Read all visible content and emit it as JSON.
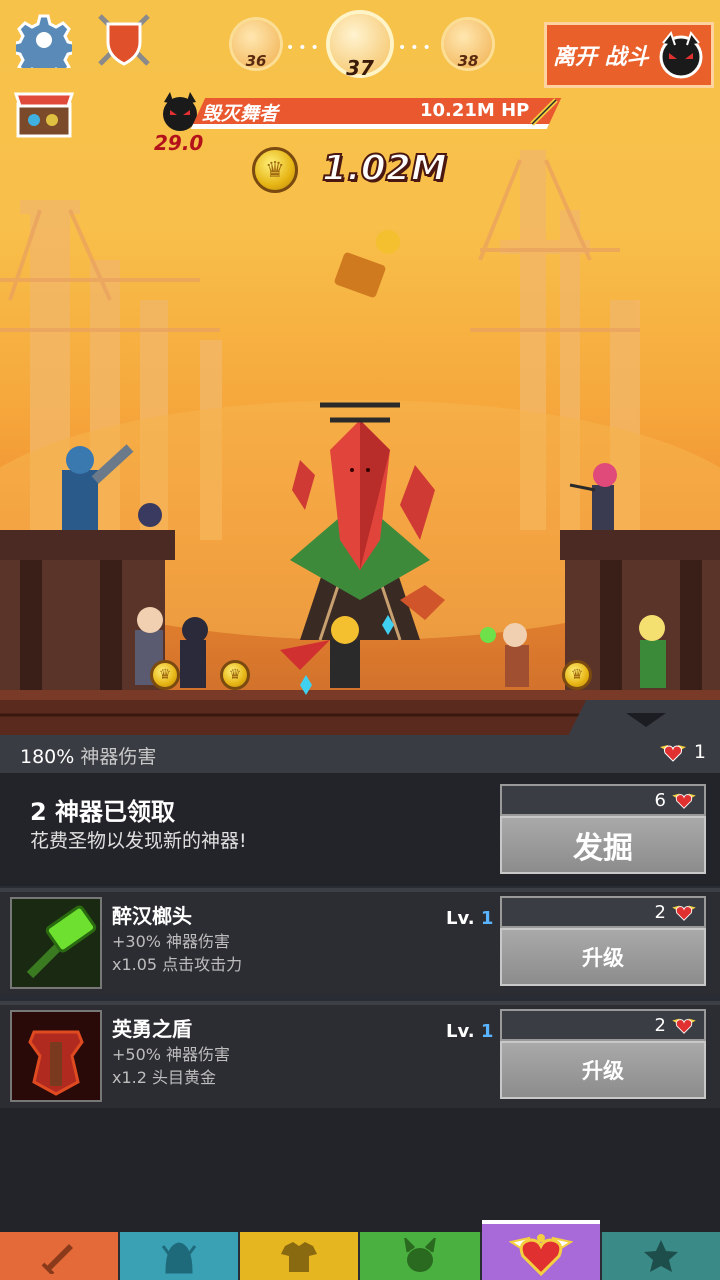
{
  "stages": [
    "36",
    "37",
    "38"
  ],
  "leave_label": "离开 战斗",
  "boss": {
    "name": "毁灭舞者",
    "hp": "10.21M HP",
    "timer": "29.0"
  },
  "gold": "1.02M",
  "damage_bonus": {
    "value": "180%",
    "label": "神器伤害"
  },
  "relics": "1",
  "dig": {
    "title": "2 神器已领取",
    "subtitle": "花费圣物以发现新的神器!",
    "cost": "6",
    "button": "发掘"
  },
  "artifacts": [
    {
      "name": "醉汉榔头",
      "effect1": "+30% 神器伤害",
      "effect2": "x1.05 点击攻击力",
      "lv_label": "Lv.",
      "lv": "1",
      "cost": "2",
      "button": "升级"
    },
    {
      "name": "英勇之盾",
      "effect1": "+50% 神器伤害",
      "effect2": "x1.2 头目黄金",
      "lv_label": "Lv.",
      "lv": "1",
      "cost": "2",
      "button": "升级"
    }
  ],
  "nav_tabs": [
    "sword-icon",
    "helmet-icon",
    "shirt-icon",
    "horned-head-icon",
    "winged-heart-icon",
    "star-icon"
  ],
  "colors": {
    "accent": "#e9602a",
    "boss_bar": "#e9582e",
    "level_num": "#5ab4ff"
  }
}
